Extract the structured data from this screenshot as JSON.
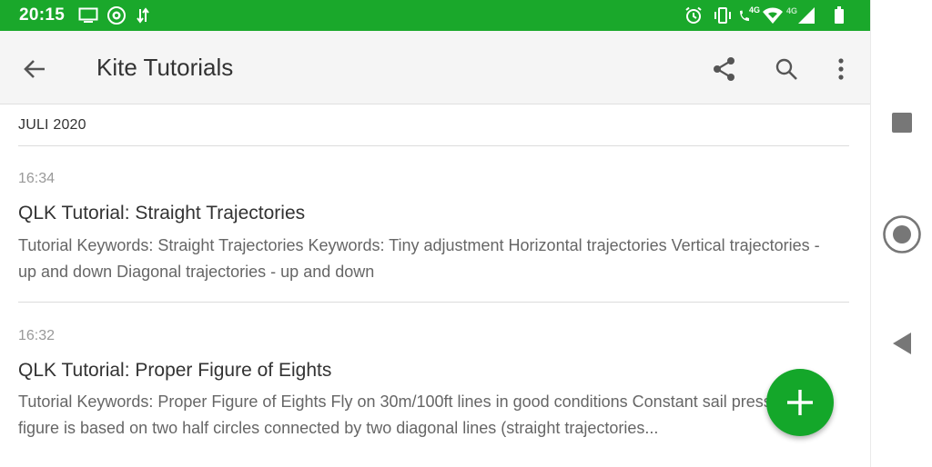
{
  "status_bar": {
    "time": "20:15",
    "background": "#1aa82b",
    "left_icons": [
      "monitor-icon",
      "vpn-eye-icon",
      "data-arrows-icon"
    ],
    "right_icons": [
      "alarm-icon",
      "vibrate-icon",
      "volte-call-icon",
      "wifi-icon",
      "mobile-signal-icon",
      "battery-icon"
    ],
    "volte_label": "4G",
    "network_label": "4G"
  },
  "app_bar": {
    "title": "Kite Tutorials",
    "back_icon": "arrow-back-icon",
    "actions": [
      "share-icon",
      "search-icon",
      "more-vert-icon"
    ]
  },
  "section": {
    "header": "JULI 2020"
  },
  "notes": [
    {
      "time": "16:34",
      "title": "QLK Tutorial: Straight Trajectories",
      "snippet": "Tutorial Keywords: Straight Trajectories Keywords: Tiny adjustment Horizontal trajectories Vertical trajectories - up and down Diagonal trajectories - up and down"
    },
    {
      "time": "16:32",
      "title": "QLK Tutorial: Proper Figure of Eights",
      "snippet": "Tutorial Keywords: Proper Figure of Eights Fly on 30m/100ft lines in good conditions Constant sail pressure The figure is based on two half circles connected by two diagonal lines (straight trajectories..."
    }
  ],
  "fab": {
    "icon": "plus-icon",
    "color": "#14a72a"
  },
  "nav_bar": {
    "icons": [
      "recents-square-icon",
      "home-circle-icon",
      "back-triangle-icon"
    ]
  }
}
